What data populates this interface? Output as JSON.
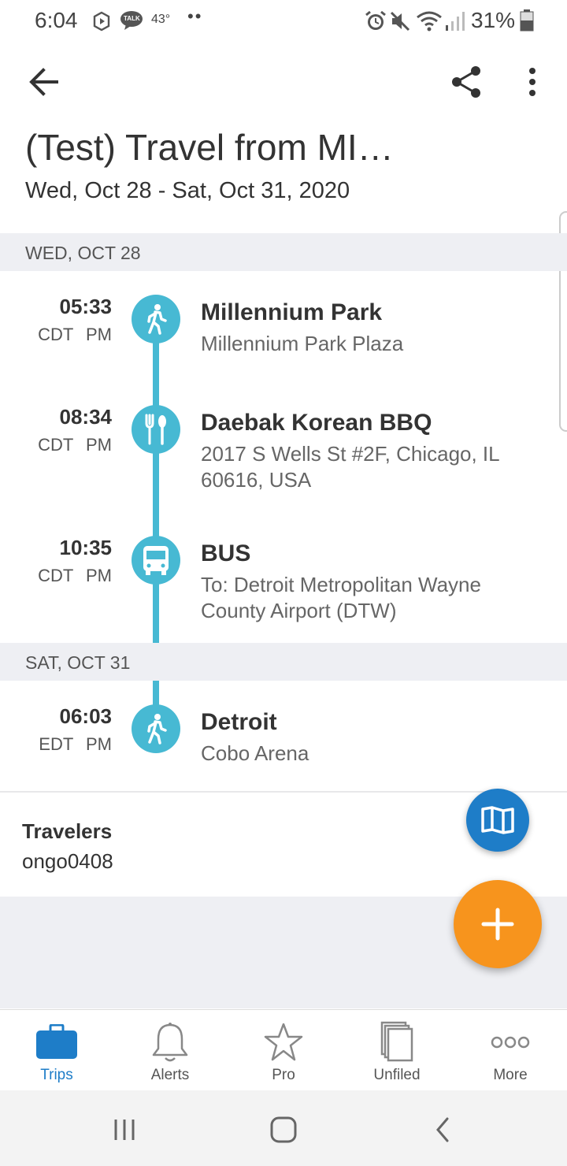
{
  "status_bar": {
    "time": "6:04",
    "temperature": "43°",
    "more_dots": "••",
    "battery": "31%",
    "icons": [
      "play-circle-icon",
      "talk-chat-icon",
      "alarm-icon",
      "mute-icon",
      "wifi-icon",
      "signal-icon",
      "battery-icon"
    ],
    "talk_badge": "TALK"
  },
  "toolbar": {
    "back_icon": "arrow-left-icon",
    "share_icon": "share-icon",
    "overflow_icon": "more-vert-icon"
  },
  "trip": {
    "title": "(Test) Travel from MI…",
    "dates": "Wed, Oct 28 - Sat, Oct 31, 2020"
  },
  "days": [
    {
      "header": "WED, OCT 28",
      "events": [
        {
          "time": "05:33",
          "tz": "CDT PM",
          "icon": "walking-icon",
          "title": "Millennium Park",
          "sub": "Millennium Park Plaza"
        },
        {
          "time": "08:34",
          "tz": "CDT PM",
          "icon": "restaurant-icon",
          "title": "Daebak Korean BBQ",
          "sub": "2017 S Wells St #2F, Chicago, IL 60616, USA"
        },
        {
          "time": "10:35",
          "tz": "CDT PM",
          "icon": "bus-icon",
          "title": "BUS",
          "sub": "To: Detroit Metropolitan Wayne County Airport (DTW)"
        }
      ]
    },
    {
      "header": "SAT, OCT 31",
      "events": [
        {
          "time": "06:03",
          "tz": "EDT PM",
          "icon": "walking-icon",
          "title": "Detroit",
          "sub": "Cobo Arena"
        }
      ]
    }
  ],
  "travelers": {
    "label": "Travelers",
    "value": "ongo0408"
  },
  "fabs": {
    "map_icon": "map-icon",
    "add_icon": "plus-icon"
  },
  "bottom_nav": [
    {
      "label": "Trips",
      "icon": "briefcase-icon",
      "active": true
    },
    {
      "label": "Alerts",
      "icon": "bell-icon",
      "active": false
    },
    {
      "label": "Pro",
      "icon": "star-icon",
      "active": false
    },
    {
      "label": "Unfiled",
      "icon": "documents-icon",
      "active": false
    },
    {
      "label": "More",
      "icon": "more-horiz-icon",
      "active": false
    }
  ],
  "system_nav": {
    "icons": [
      "recent-apps-icon",
      "home-icon",
      "system-back-icon"
    ]
  },
  "colors": {
    "timeline": "#47b9d3",
    "accent_blue": "#1e7dc8",
    "fab_orange": "#f7941d",
    "section_bg": "#eeeff3"
  }
}
